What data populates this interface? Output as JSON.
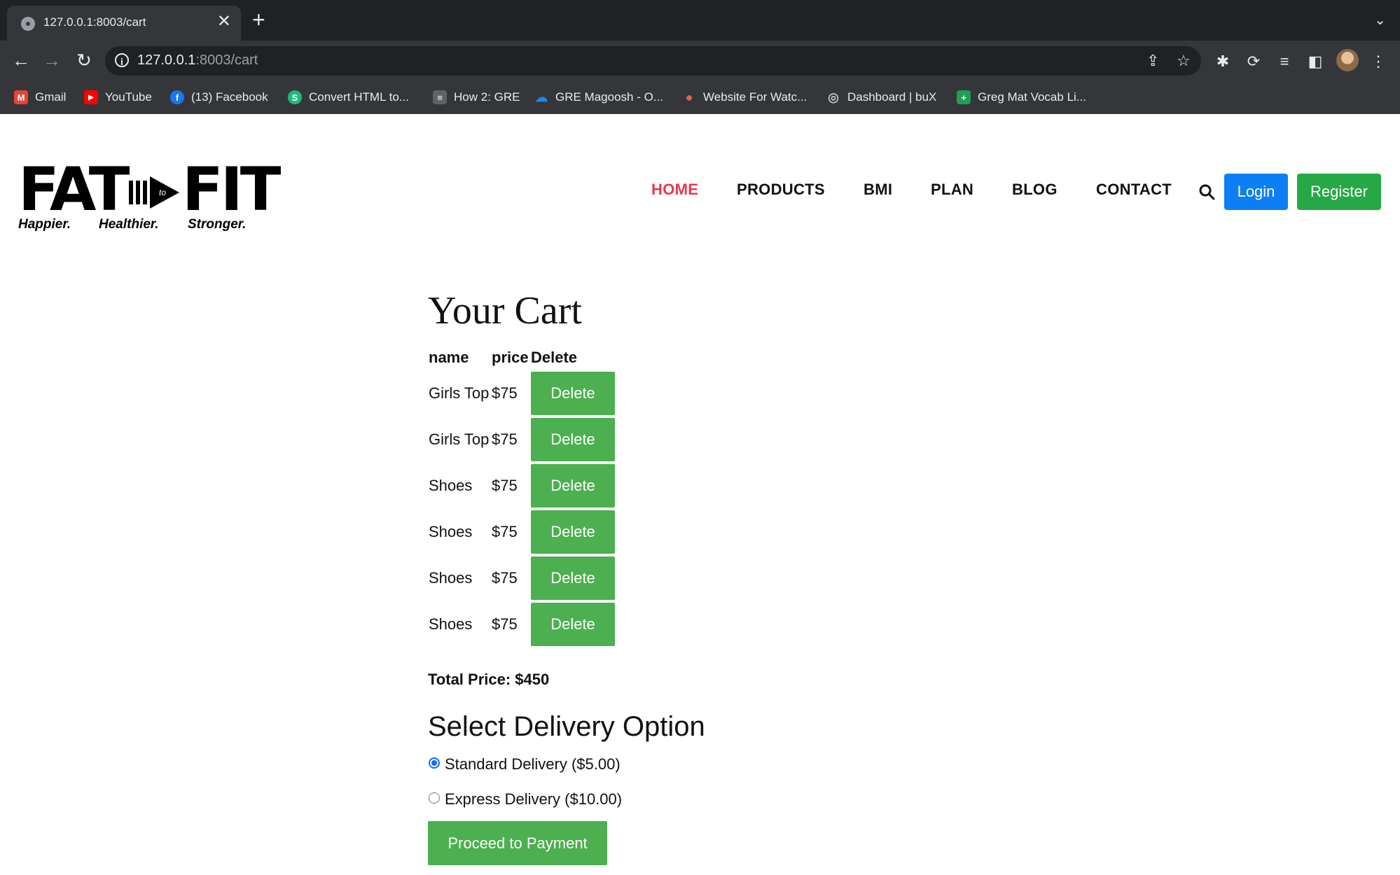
{
  "browser": {
    "tab_title": "127.0.0.1:8003/cart",
    "tab_close": "✕",
    "new_tab": "+",
    "url_host": "127.0.0.1",
    "url_path": ":8003/cart",
    "bookmarks": [
      {
        "label": "Gmail",
        "icon": "gmail-icon",
        "color": "#ea4335",
        "glyph": "M"
      },
      {
        "label": "YouTube",
        "icon": "youtube-icon",
        "color": "#ff0000",
        "glyph": "▶"
      },
      {
        "label": "(13) Facebook",
        "icon": "facebook-icon",
        "color": "#1877f2",
        "glyph": "f"
      },
      {
        "label": "Convert HTML to...",
        "icon": "convert-html-icon",
        "color": "#1db980",
        "glyph": "S"
      },
      {
        "label": "How 2: GRE",
        "icon": "document-icon",
        "color": "#9aa0a6",
        "glyph": "≡"
      },
      {
        "label": "GRE Magoosh - O...",
        "icon": "onedrive-icon",
        "color": "#1e88e5",
        "glyph": "☁"
      },
      {
        "label": "Website For Watc...",
        "icon": "website-icon",
        "color": "#e8643a",
        "glyph": "●"
      },
      {
        "label": "Dashboard | buX",
        "icon": "bux-icon",
        "color": "#7a7d82",
        "glyph": "◎"
      },
      {
        "label": "Greg Mat Vocab Li...",
        "icon": "sheets-icon",
        "color": "#1e9e54",
        "glyph": "+"
      }
    ]
  },
  "site": {
    "logo": {
      "fat": "FAT",
      "to": "to",
      "fit": "FIT",
      "tag1": "Happier.",
      "tag2": "Healthier.",
      "tag3": "Stronger."
    },
    "nav": [
      "HOME",
      "PRODUCTS",
      "BMI",
      "PLAN",
      "BLOG",
      "CONTACT"
    ],
    "login_label": "Login",
    "register_label": "Register",
    "colors": {
      "active": "#e53950",
      "login": "#0d7ff5",
      "register": "#27a846",
      "action": "#4caf50"
    }
  },
  "cart": {
    "title": "Your Cart",
    "headers": {
      "name": "name",
      "price": "price",
      "delete": "Delete"
    },
    "items": [
      {
        "name": "Girls Top",
        "price": "$75",
        "action": "Delete"
      },
      {
        "name": "Girls Top",
        "price": "$75",
        "action": "Delete"
      },
      {
        "name": "Shoes",
        "price": "$75",
        "action": "Delete"
      },
      {
        "name": "Shoes",
        "price": "$75",
        "action": "Delete"
      },
      {
        "name": "Shoes",
        "price": "$75",
        "action": "Delete"
      },
      {
        "name": "Shoes",
        "price": "$75",
        "action": "Delete"
      }
    ],
    "total_label": "Total Price: $450",
    "delivery_title": "Select Delivery Option",
    "options": [
      {
        "label": "Standard Delivery ($5.00)",
        "checked": true
      },
      {
        "label": "Express Delivery ($10.00)",
        "checked": false
      }
    ],
    "pay_label": "Proceed to Payment"
  }
}
